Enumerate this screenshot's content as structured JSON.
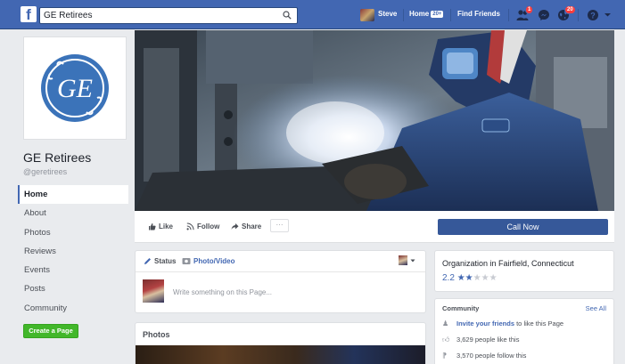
{
  "topbar": {
    "logo_letter": "f",
    "search_value": "GE Retirees",
    "user_name": "Steve",
    "home_label": "Home",
    "home_badge": "20+",
    "find_friends_label": "Find Friends",
    "friend_requests_badge": "1",
    "notifications_badge": "20"
  },
  "page": {
    "name": "GE Retirees",
    "handle": "@geretirees",
    "logo_text": "GE"
  },
  "left_nav": {
    "items": [
      {
        "label": "Home"
      },
      {
        "label": "About"
      },
      {
        "label": "Photos"
      },
      {
        "label": "Reviews"
      },
      {
        "label": "Events"
      },
      {
        "label": "Posts"
      },
      {
        "label": "Community"
      }
    ],
    "active_index": 0,
    "create_page_label": "Create a Page"
  },
  "actions": {
    "like_label": "Like",
    "follow_label": "Follow",
    "share_label": "Share",
    "more_label": "···",
    "call_now_label": "Call Now"
  },
  "composer": {
    "status_label": "Status",
    "photo_video_label": "Photo/Video",
    "placeholder": "Write something on this Page..."
  },
  "photos": {
    "title": "Photos"
  },
  "info": {
    "category": "Organization in Fairfield, Connecticut",
    "rating_text": "2.2",
    "rating_value": 2.2,
    "rating_max": 5
  },
  "community": {
    "title": "Community",
    "see_all_label": "See All",
    "invite_link": "Invite your friends",
    "invite_suffix": " to like this Page",
    "likes_text": "3,629 people like this",
    "follows_text": "3,570 people follow this"
  },
  "colors": {
    "brand_blue": "#4267b2",
    "ge_blue": "#3b73b9",
    "create_green": "#42b72a"
  }
}
